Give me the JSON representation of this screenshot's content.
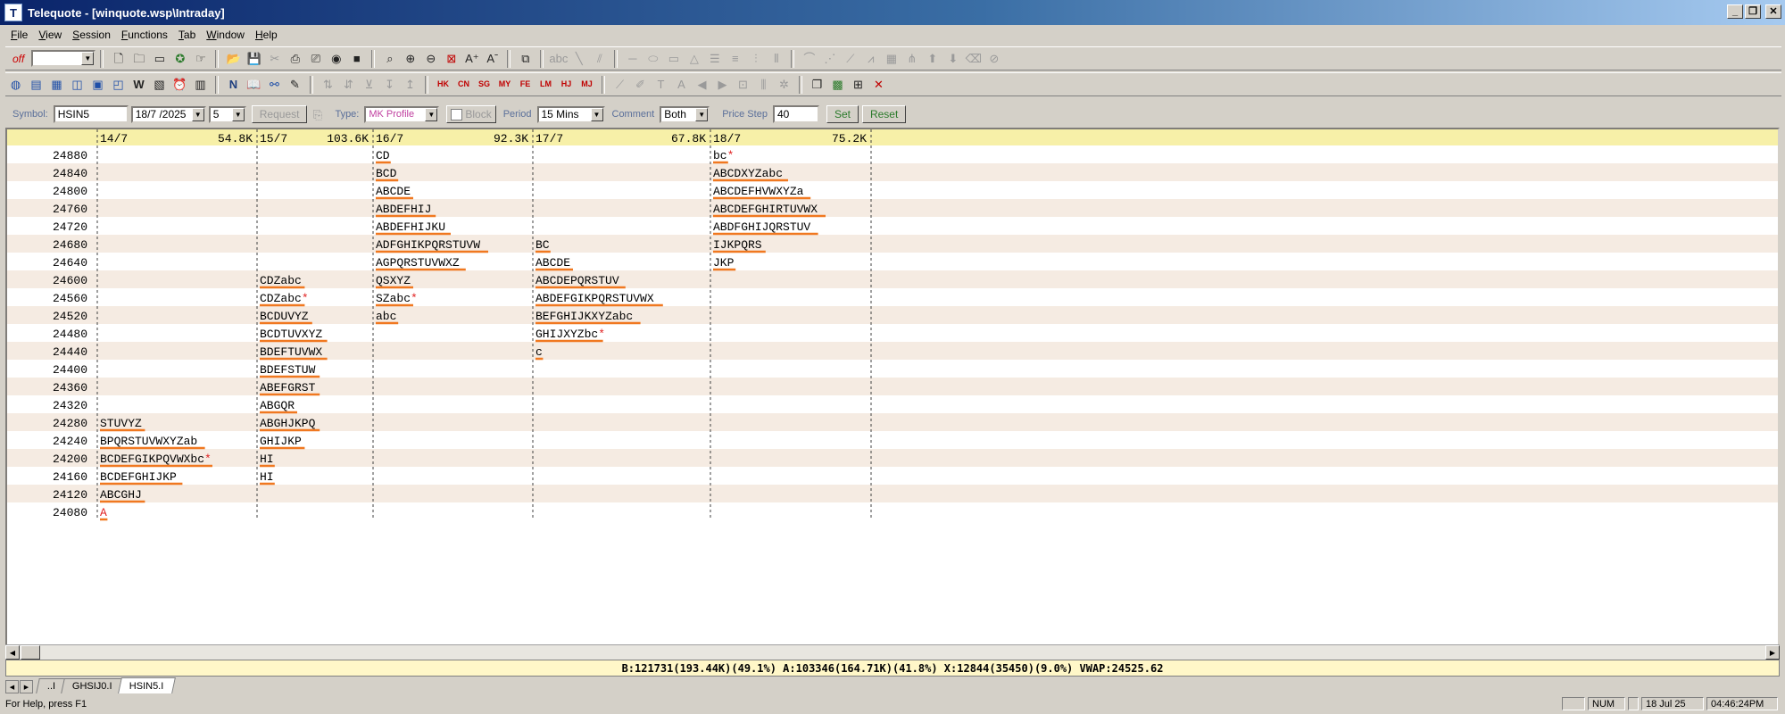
{
  "window": {
    "title": "Telequote - [winquote.wsp\\Intraday]",
    "app_icon": "T"
  },
  "menu": [
    "File",
    "View",
    "Session",
    "Functions",
    "Tab",
    "Window",
    "Help"
  ],
  "toolbar": {
    "status": "off"
  },
  "params": {
    "symbol_label": "Symbol:",
    "symbol_value": "HSIN5",
    "date_value": "18/7 /2025",
    "days_value": "5",
    "request_label": "Request",
    "type_label": "Type:",
    "type_value": "MK Profile",
    "block_label": "Block",
    "period_label": "Period",
    "period_value": "15 Mins",
    "comment_label": "Comment",
    "comment_value": "Both",
    "pricestep_label": "Price Step",
    "pricestep_value": "40",
    "set_label": "Set",
    "reset_label": "Reset"
  },
  "chart_data": {
    "type": "table",
    "prices": [
      24880,
      24840,
      24800,
      24760,
      24720,
      24680,
      24640,
      24600,
      24560,
      24520,
      24480,
      24440,
      24400,
      24360,
      24320,
      24280,
      24240,
      24200,
      24160,
      24120,
      24080
    ],
    "days": [
      {
        "date": "14/7",
        "volume": "54.8K",
        "profile": {
          "24280": "STUVYZ",
          "24240": "BPQRSTUVWXYZab",
          "24200": "BCDEFGIKPQVWXbc*",
          "24160": "BCDEFGHIJKP",
          "24120": "ABCGHJ",
          "24080": "A"
        }
      },
      {
        "date": "15/7",
        "volume": "103.6K",
        "profile": {
          "24600": "CDZabc",
          "24560": "CDZabc*",
          "24520": "BCDUVYZ",
          "24480": "BCDTUVXYZ",
          "24440": "BDEFTUVWX",
          "24400": "BDEFSTUW",
          "24360": "ABEFGRST",
          "24320": "ABGQR",
          "24280": "ABGHJKPQ",
          "24240": "GHIJKP",
          "24200": "HI",
          "24160": "HI"
        }
      },
      {
        "date": "16/7",
        "volume": "92.3K",
        "profile": {
          "24880": "CD",
          "24840": "BCD",
          "24800": "ABCDE",
          "24760": "ABDEFHIJ",
          "24720": "ABDEFHIJKU",
          "24680": "ADFGHIKPQRSTUVW",
          "24640": "AGPQRSTUVWXZ",
          "24600": "QSXYZ",
          "24560": "SZabc*",
          "24520": "abc"
        }
      },
      {
        "date": "17/7",
        "volume": "67.8K",
        "profile": {
          "24680": "BC",
          "24640": "ABCDE",
          "24600": "ABCDEPQRSTUV",
          "24560": "ABDEFGIKPQRSTUVWX",
          "24520": "BEFGHIJKXYZabc",
          "24480": "GHIJXYZbc*",
          "24440": "c"
        }
      },
      {
        "date": "18/7",
        "volume": "75.2K",
        "profile": {
          "24880": "bc*",
          "24840": "ABCDXYZabc",
          "24800": "ABCDEFHVWXYZa",
          "24760": "ABCDEFGHIRTUVWX",
          "24720": "ABDFGHIJQRSTUV",
          "24680": "IJKPQRS",
          "24640": "JKP"
        }
      }
    ],
    "grid": true
  },
  "stats": "B:121731(193.44K)(49.1%)  A:103346(164.71K)(41.8%) X:12844(35450)(9.0%) VWAP:24525.62",
  "tabs": [
    "..I",
    "GHSIJ0.I",
    "HSIN5.I"
  ],
  "status": {
    "help": "For Help, press F1",
    "num": "NUM",
    "date": "18 Jul 25",
    "time": "04:46:24PM"
  },
  "colors": {
    "title_bar": "#0a246a",
    "header_bg": "#f7f0a8",
    "row_alt": "#f5ebe2",
    "underline": "#f07820",
    "open_red": "#e02020",
    "text": "#000000"
  }
}
